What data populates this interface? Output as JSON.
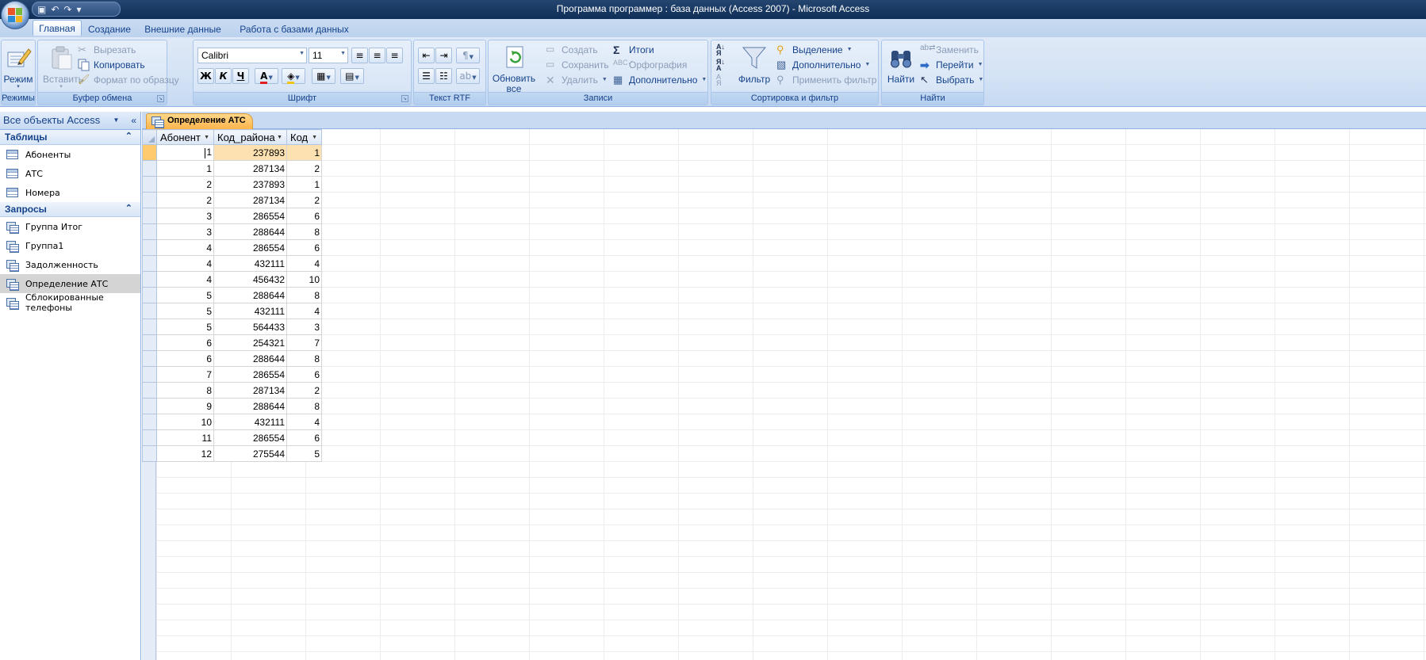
{
  "window": {
    "title": "Программа программер : база данных (Access 2007) - Microsoft Access"
  },
  "ribbon_tabs": [
    {
      "label": "Главная",
      "active": true
    },
    {
      "label": "Создание",
      "active": false
    },
    {
      "label": "Внешние данные",
      "active": false
    },
    {
      "label": "Работа с базами данных",
      "active": false
    }
  ],
  "groups": {
    "views": {
      "label": "Режимы",
      "view_button": "Режим"
    },
    "clipboard": {
      "label": "Буфер обмена",
      "paste": "Вставить",
      "cut": "Вырезать",
      "copy": "Копировать",
      "format_painter": "Формат по образцу"
    },
    "font": {
      "label": "Шрифт",
      "font_name": "Calibri",
      "font_size": "11",
      "bold": "Ж",
      "italic": "К",
      "underline": "Ч",
      "font_color": "A"
    },
    "rich_text": {
      "label": "Текст RTF"
    },
    "records": {
      "label": "Записи",
      "refresh": "Обновить все",
      "new": "Создать",
      "save": "Сохранить",
      "delete": "Удалить",
      "totals": "Итоги",
      "spelling": "Орфография",
      "more": "Дополнительно"
    },
    "sort_filter": {
      "label": "Сортировка и фильтр",
      "filter": "Фильтр",
      "selection": "Выделение",
      "advanced": "Дополнительно",
      "toggle_filter": "Применить фильтр"
    },
    "find": {
      "label": "Найти",
      "find": "Найти",
      "replace": "Заменить",
      "goto": "Перейти",
      "select": "Выбрать"
    }
  },
  "nav": {
    "header": "Все объекты Access",
    "sections": [
      {
        "label": "Таблицы",
        "items": [
          "Абоненты",
          "АТС",
          "Номера"
        ]
      },
      {
        "label": "Запросы",
        "items": [
          "Группа Итог",
          "Группа1",
          "Задолженность",
          "Определение АТС",
          "Сблокированные телефоны"
        ]
      }
    ],
    "selected_item": "Определение АТС"
  },
  "document": {
    "tab_label": "Определение АТС",
    "columns": [
      "Абонент",
      "Код_района",
      "Код"
    ],
    "rows": [
      [
        "1",
        "237893",
        "1"
      ],
      [
        "1",
        "287134",
        "2"
      ],
      [
        "2",
        "237893",
        "1"
      ],
      [
        "2",
        "287134",
        "2"
      ],
      [
        "3",
        "286554",
        "6"
      ],
      [
        "3",
        "288644",
        "8"
      ],
      [
        "4",
        "286554",
        "6"
      ],
      [
        "4",
        "432111",
        "4"
      ],
      [
        "4",
        "456432",
        "10"
      ],
      [
        "5",
        "288644",
        "8"
      ],
      [
        "5",
        "432111",
        "4"
      ],
      [
        "5",
        "564433",
        "3"
      ],
      [
        "6",
        "254321",
        "7"
      ],
      [
        "6",
        "288644",
        "8"
      ],
      [
        "7",
        "286554",
        "6"
      ],
      [
        "8",
        "287134",
        "2"
      ],
      [
        "9",
        "288644",
        "8"
      ],
      [
        "10",
        "432111",
        "4"
      ],
      [
        "11",
        "286554",
        "6"
      ],
      [
        "12",
        "275544",
        "5"
      ]
    ]
  },
  "colors": {
    "accent": "#15428b",
    "titlebar": "#1b3c66",
    "current_row": "#fde1b0",
    "active_tab": "#ffb44b"
  }
}
